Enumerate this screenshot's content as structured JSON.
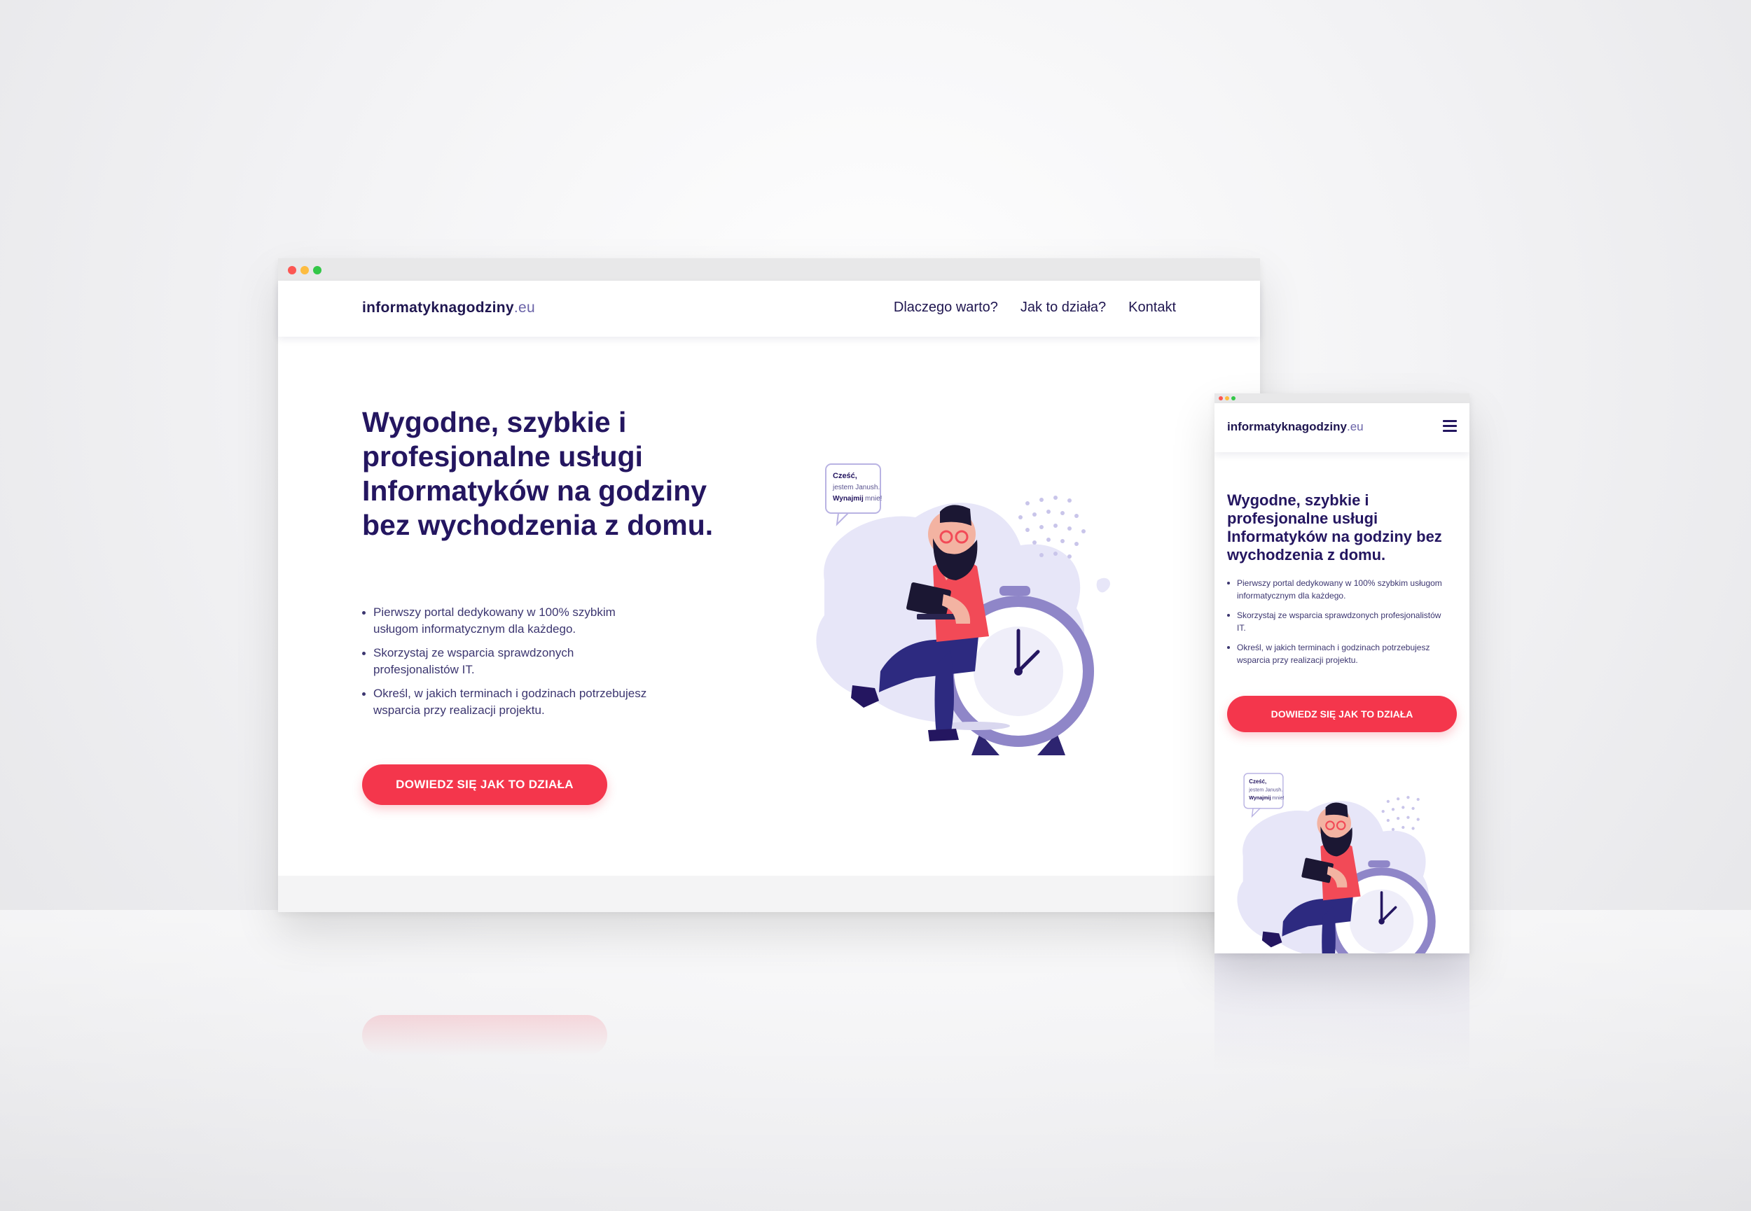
{
  "desktop": {
    "logo": {
      "name": "informatyknagodziny",
      "tld": ".eu"
    },
    "nav": [
      "Dlaczego warto?",
      "Jak to działa?",
      "Kontakt"
    ],
    "hero": {
      "title": "Wygodne, szybkie i profesjonalne usługi Informatyków na godziny bez wychodzenia z domu.",
      "bullets": [
        "Pierwszy portal dedykowany w 100% szybkim usługom informatycznym dla każdego.",
        "Skorzystaj ze wsparcia sprawdzonych profesjonalistów IT.",
        "Określ, w jakich terminach i godzinach potrzebujesz wsparcia przy realizacji projektu."
      ],
      "cta": "DOWIEDZ SIĘ JAK TO DZIAŁA"
    },
    "speech": {
      "greeting": "Cześć,",
      "intro": "jestem Janush.",
      "hire": "Wynajmij",
      "me": "mnie!"
    }
  },
  "mobile": {
    "logo": {
      "name": "informatyknagodziny",
      "tld": ".eu"
    },
    "hero": {
      "title": "Wygodne, szybkie i profesjonalne usługi Informatyków na godziny bez wychodzenia z domu.",
      "bullets": [
        "Pierwszy portal dedykowany w 100% szybkim usługom informatycznym dla każdego.",
        "Skorzystaj ze wsparcia sprawdzonych profesjonalistów IT.",
        "Określ, w jakich terminach i godzinach potrzebujesz wsparcia przy realizacji projektu."
      ],
      "cta": "DOWIEDZ SIĘ JAK TO DZIAŁA"
    },
    "speech": {
      "greeting": "Cześć,",
      "intro": "jestem Janush.",
      "hire": "Wynajmij",
      "me": "mnie!"
    }
  },
  "colors": {
    "primary_dark": "#241660",
    "cta_red": "#f4364c",
    "blob_lavender": "#e7e6f8",
    "clock_purple": "#8f86c8",
    "shirt_red": "#f24a57"
  },
  "icons": [
    "hamburger-menu-icon",
    "window-close-dot-icon",
    "window-minimize-dot-icon",
    "window-maximize-dot-icon"
  ]
}
